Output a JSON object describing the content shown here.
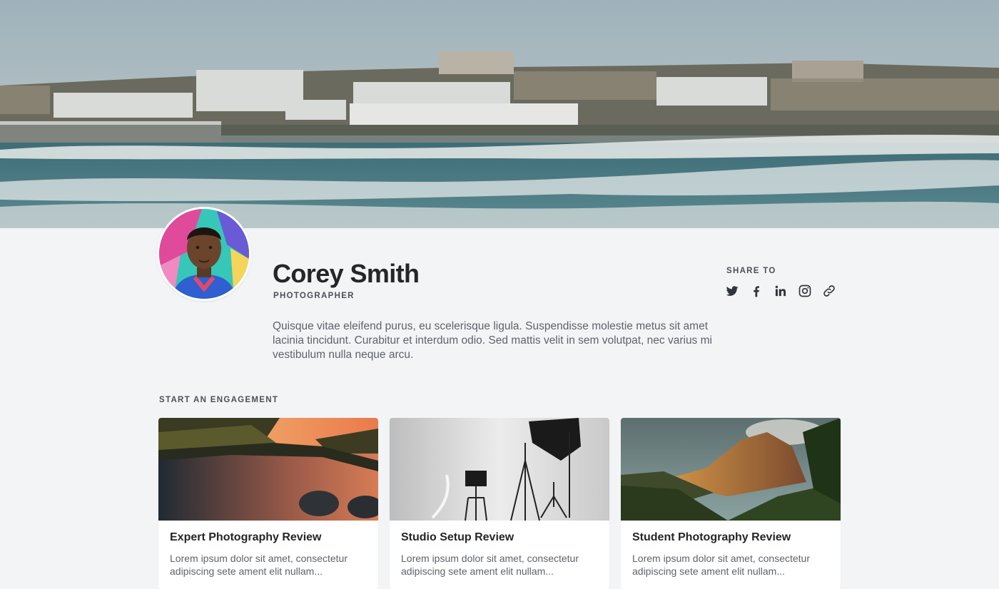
{
  "profile": {
    "name": "Corey Smith",
    "role": "PHOTOGRAPHER",
    "bio": "Quisque vitae eleifend purus, eu scelerisque ligula. Suspendisse molestie metus sit amet lacinia tincidunt. Curabitur et interdum odio. Sed mattis velit in sem volutpat, nec varius mi vestibulum nulla neque arcu."
  },
  "share": {
    "label": "SHARE TO",
    "icons": [
      "twitter-icon",
      "facebook-icon",
      "linkedin-icon",
      "instagram-icon",
      "link-icon"
    ]
  },
  "engagement": {
    "label": "START AN ENGAGEMENT",
    "cards": [
      {
        "title": "Expert Photography Review",
        "description": "Lorem ipsum dolor sit amet, consectetur adipiscing sete ament elit nullam..."
      },
      {
        "title": "Studio Setup Review",
        "description": "Lorem ipsum dolor sit amet, consectetur adipiscing sete ament elit nullam..."
      },
      {
        "title": "Student Photography Review",
        "description": "Lorem ipsum dolor sit amet, consectetur adipiscing sete ament elit nullam..."
      }
    ]
  },
  "colors": {
    "background": "#f3f4f6",
    "heading": "#262626",
    "muted_text": "#5e636b",
    "label_text": "#4b5057"
  }
}
